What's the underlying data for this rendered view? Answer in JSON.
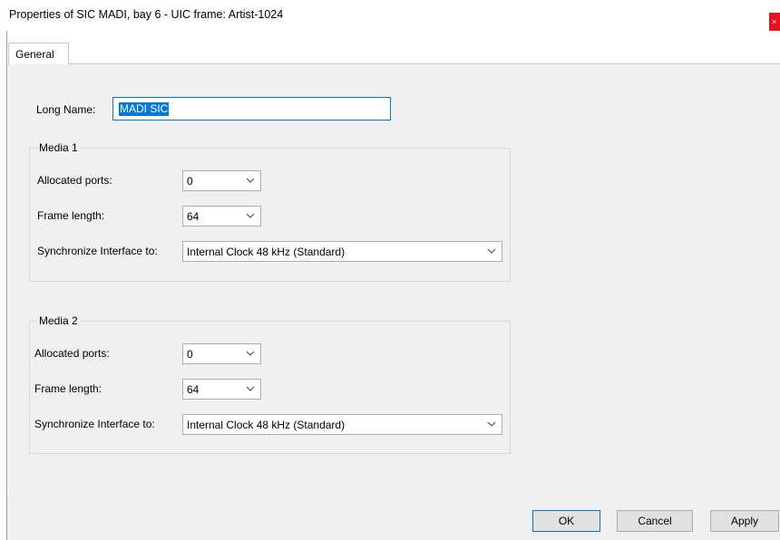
{
  "window": {
    "title": "Properties of SIC MADI, bay 6 - UIC frame: Artist-1024",
    "close_glyph": "×"
  },
  "tabs": [
    {
      "label": "General",
      "selected": true
    }
  ],
  "long_name": {
    "label": "Long Name:",
    "value": "MADI SIC"
  },
  "media1": {
    "legend": "Media 1",
    "allocated_ports": {
      "label": "Allocated ports:",
      "value": "0"
    },
    "frame_length": {
      "label": "Frame length:",
      "value": "64"
    },
    "sync": {
      "label": "Synchronize Interface to:",
      "value": "Internal Clock 48 kHz (Standard)"
    }
  },
  "media2": {
    "legend": "Media 2",
    "allocated_ports": {
      "label": "Allocated ports:",
      "value": "0"
    },
    "frame_length": {
      "label": "Frame length:",
      "value": "64"
    },
    "sync": {
      "label": "Synchronize Interface to:",
      "value": "Internal Clock 48 kHz (Standard)"
    }
  },
  "buttons": {
    "ok": "OK",
    "cancel": "Cancel",
    "apply": "Apply"
  },
  "colors": {
    "selection": "#0078d7",
    "panel": "#f0f0f0",
    "close": "#e81123"
  }
}
